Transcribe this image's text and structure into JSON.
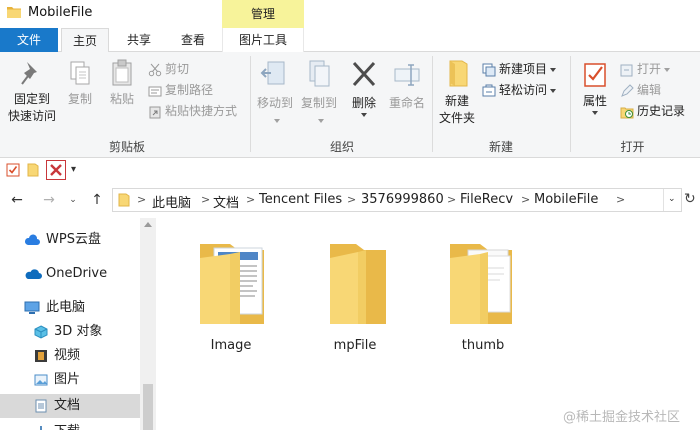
{
  "window": {
    "title": "MobileFile",
    "manage_label": "管理"
  },
  "tabs": {
    "file": "文件",
    "home": "主页",
    "share": "共享",
    "view": "查看",
    "picture_tools": "图片工具"
  },
  "ribbon": {
    "clipboard": {
      "pin_label_line1": "固定到",
      "pin_label_line2": "快速访问",
      "copy": "复制",
      "paste": "粘贴",
      "cut": "剪切",
      "copy_path": "复制路径",
      "paste_shortcut": "粘贴快捷方式",
      "group_label": "剪贴板"
    },
    "organize": {
      "move_to": "移动到",
      "copy_to": "复制到",
      "delete": "删除",
      "rename": "重命名",
      "group_label": "组织"
    },
    "new": {
      "new_folder_line1": "新建",
      "new_folder_line2": "文件夹",
      "new_item": "新建项目",
      "easy_access": "轻松访问",
      "group_label": "新建"
    },
    "open": {
      "properties": "属性",
      "open": "打开",
      "edit": "编辑",
      "history": "历史记录",
      "group_label": "打开"
    }
  },
  "address": {
    "crumbs": [
      "此电脑",
      "文档",
      "Tencent Files",
      "3576999860",
      "FileRecv",
      "MobileFile"
    ]
  },
  "nav_pane": {
    "items": [
      "WPS云盘",
      "OneDrive",
      "此电脑",
      "3D 对象",
      "视频",
      "图片",
      "文档",
      "下载"
    ],
    "selected": "文档"
  },
  "files": [
    {
      "name": "Image",
      "type": "folder-with-images"
    },
    {
      "name": "mpFile",
      "type": "folder-empty"
    },
    {
      "name": "thumb",
      "type": "folder-with-docs"
    }
  ],
  "watermark": "@稀土掘金技术社区",
  "colors": {
    "file_tab": "#1979ca",
    "manage_tab": "#f7f39a",
    "folder": "#f8d775",
    "delete_red": "#c8373b"
  }
}
